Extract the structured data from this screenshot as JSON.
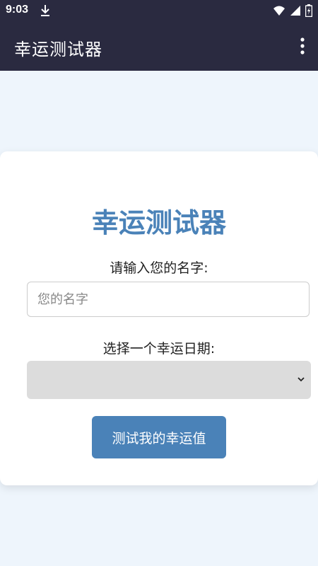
{
  "status_bar": {
    "time": "9:03",
    "icons": [
      "download-icon",
      "wifi-icon",
      "signal-icon",
      "battery-icon"
    ]
  },
  "app_bar": {
    "title": "幸运测试器",
    "menu_icon": "more-vert-icon"
  },
  "form": {
    "heading": "幸运测试器",
    "name_label": "请输入您的名字:",
    "name_placeholder": "您的名字",
    "name_value": "",
    "date_label": "选择一个幸运日期:",
    "date_selected": "",
    "submit_label": "测试我的幸运值"
  },
  "colors": {
    "app_bar_bg": "#2a2a40",
    "page_bg": "#eef5fc",
    "accent": "#4a82b8",
    "select_bg": "#dcdcdc"
  }
}
